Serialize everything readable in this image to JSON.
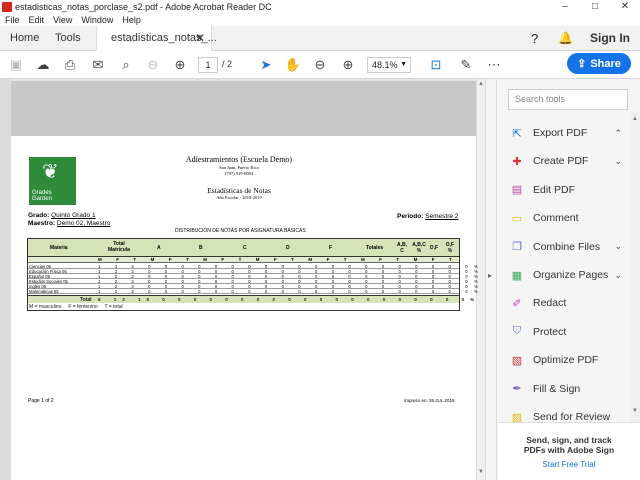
{
  "window": {
    "title": "estadisticas_notas_porclase_s2.pdf - Adobe Acrobat Reader DC",
    "controls": [
      "–",
      "□",
      "✕"
    ]
  },
  "menu": [
    "File",
    "Edit",
    "View",
    "Window",
    "Help"
  ],
  "tabs": {
    "home": "Home",
    "tools": "Tools",
    "document": "estadisticas_notas_...",
    "signin": "Sign In"
  },
  "toolbar": {
    "page_current": "1",
    "page_total": "/ 2",
    "zoom": "48.1%",
    "share": "Share"
  },
  "right_panel": {
    "search_placeholder": "Search tools",
    "tools": [
      {
        "label": "Export PDF",
        "icon": "export-pdf-icon",
        "color": "#1473e6",
        "chevron": "up"
      },
      {
        "label": "Create PDF",
        "icon": "create-pdf-icon",
        "color": "#d7373f",
        "chevron": "down"
      },
      {
        "label": "Edit PDF",
        "icon": "edit-pdf-icon",
        "color": "#c43fa6",
        "chevron": ""
      },
      {
        "label": "Comment",
        "icon": "comment-icon",
        "color": "#e5b900",
        "chevron": ""
      },
      {
        "label": "Combine Files",
        "icon": "combine-files-icon",
        "color": "#5c6bd8",
        "chevron": "down"
      },
      {
        "label": "Organize Pages",
        "icon": "organize-pages-icon",
        "color": "#35a853",
        "chevron": "down"
      },
      {
        "label": "Redact",
        "icon": "redact-icon",
        "color": "#c43fa6",
        "chevron": ""
      },
      {
        "label": "Protect",
        "icon": "protect-icon",
        "color": "#5c6bd8",
        "chevron": ""
      },
      {
        "label": "Optimize PDF",
        "icon": "optimize-pdf-icon",
        "color": "#d7373f",
        "chevron": ""
      },
      {
        "label": "Fill & Sign",
        "icon": "fill-sign-icon",
        "color": "#7e5cc4",
        "chevron": ""
      },
      {
        "label": "Send for Review",
        "icon": "send-review-icon",
        "color": "#e5b900",
        "chevron": ""
      }
    ],
    "promo_line1": "Send, sign, and track",
    "promo_line2": "PDFs with Adobe Sign",
    "promo_link": "Start Free Trial"
  },
  "document": {
    "logo_text1": "Grades",
    "logo_text2": "Garden",
    "school": "Adiestramientos (Escuela Demo)",
    "city": "San Juan, Puerto Rico",
    "phone": "(787) 919-0084",
    "report_title": "Estadísticas de Notas",
    "school_year": "Año Escolar - 2018-2019",
    "grado_label": "Grado:",
    "grado_value": "Quinto Grado 1",
    "maestro_label": "Maestro:",
    "maestro_value": "Demo 02, Maestro",
    "periodo_label": "Periodo:",
    "periodo_value": "Semestre 2",
    "subtitle": "DISTRIBUCIÓN DE NOTAS POR ASIGNATURA BÁSICAS",
    "columns": [
      "Materia",
      "Total Matrícula",
      "A",
      "B",
      "C",
      "D",
      "F",
      "Totales",
      "A,B, C",
      "A,B,C %",
      "D,F",
      "D,F %"
    ],
    "subheaders": "M F T M F T M F T M F T M F T M F T M F T",
    "rows": [
      {
        "name": "Ciencias 05",
        "vals": "1 3 4 0 0 0 0 0 0 0 0 0 0 0 0 0 0 0 0 0 0 0 0% 0 0%"
      },
      {
        "name": "Educación Física 05",
        "vals": "1 2 3 0 0 0 0 0 0 0 0 0 0 0 0 0 0 0 0 0 0 0 0% 0 0%"
      },
      {
        "name": "Español 05",
        "vals": "1 2 3 0 0 0 0 0 0 0 0 0 0 0 0 0 0 0 0 0 0 0 0% 0 0%"
      },
      {
        "name": "Estudios Sociales 05",
        "vals": "1 2 3 0 0 0 0 0 0 0 0 0 0 0 0 0 0 0 0 0 0 0 0% 0 0%"
      },
      {
        "name": "Inglés 05",
        "vals": "1 2 3 0 0 0 0 0 0 0 0 0 0 0 0 0 0 0 0 0 0 0 0% 0 0%"
      },
      {
        "name": "Matemáticas 05",
        "vals": "1 2 3 0 0 0 0 0 0 0 0 0 0 0 0 0 0 0 0 0 0 0 0% 0 0%"
      }
    ],
    "total_label": "Total",
    "total_vals": "6 13 19 0 0 0 0 0 0 0 0 0 0 0 0 0 0 0 0 0 0 0 0% 0 0%",
    "legend": "M = masculino     F = femenino     T = total",
    "page_label": "Page 1 of 2",
    "printed": "Impreso en: 26.JUL.2018"
  }
}
